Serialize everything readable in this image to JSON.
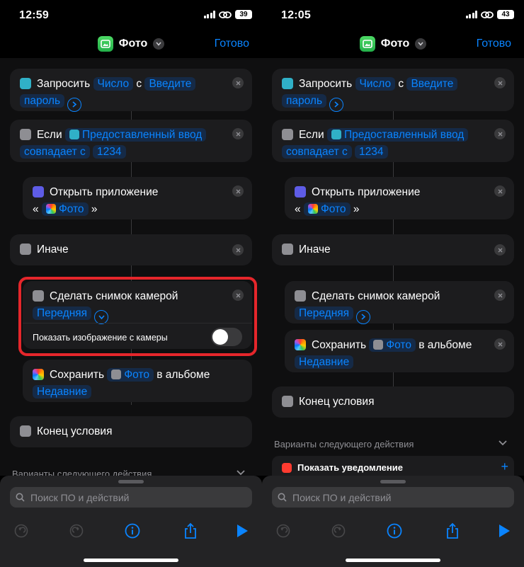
{
  "left": {
    "status": {
      "time": "12:59",
      "battery": "39"
    },
    "nav": {
      "title": "Фото",
      "done": "Готово"
    },
    "ask": {
      "label": "Запросить",
      "type": "Число",
      "with": "с",
      "prompt_a": "Введите",
      "prompt_b": "пароль"
    },
    "ifblock": {
      "label": "Если",
      "input": "Предоставленный ввод",
      "cond": "совпадает с",
      "value": "1234"
    },
    "open_app": {
      "label": "Открыть приложение",
      "quote_l": "«",
      "app": "Фото",
      "quote_r": "»"
    },
    "otherwise": "Иначе",
    "camera": {
      "label": "Сделать снимок камерой",
      "camera": "Передняя",
      "show_preview": "Показать изображение с камеры",
      "show_preview_on": false
    },
    "save": {
      "label": "Сохранить",
      "item": "Фото",
      "in_album": "в альбоме",
      "album": "Недавние"
    },
    "endif": "Конец условия",
    "next_actions": "Варианты следующего действия",
    "search_placeholder": "Поиск ПО и действий"
  },
  "right": {
    "status": {
      "time": "12:05",
      "battery": "43"
    },
    "nav": {
      "title": "Фото",
      "done": "Готово"
    },
    "ask": {
      "label": "Запросить",
      "type": "Число",
      "with": "с",
      "prompt_a": "Введите",
      "prompt_b": "пароль"
    },
    "ifblock": {
      "label": "Если",
      "input": "Предоставленный ввод",
      "cond": "совпадает с",
      "value": "1234"
    },
    "open_app": {
      "label": "Открыть приложение",
      "quote_l": "«",
      "app": "Фото",
      "quote_r": "»"
    },
    "otherwise": "Иначе",
    "camera": {
      "label": "Сделать снимок камерой",
      "camera": "Передняя"
    },
    "save": {
      "label": "Сохранить",
      "item": "Фото",
      "in_album": "в альбоме",
      "album": "Недавние"
    },
    "endif": "Конец условия",
    "next_actions": "Варианты следующего действия",
    "suggestion": "Показать уведомление",
    "search_placeholder": "Поиск ПО и действий"
  },
  "colors": {
    "accent": "#0a84ff",
    "highlight": "#e5262b",
    "card": "#1c1c1e"
  },
  "icons": [
    "photos-app-icon",
    "ask-icon",
    "if-icon",
    "open-app-icon",
    "camera-icon",
    "photos-icon",
    "undo-icon",
    "redo-icon",
    "info-icon",
    "share-icon",
    "play-icon",
    "search-icon",
    "close-icon",
    "chevron-down-icon",
    "chevron-right-icon",
    "plus-icon",
    "notification-icon"
  ]
}
